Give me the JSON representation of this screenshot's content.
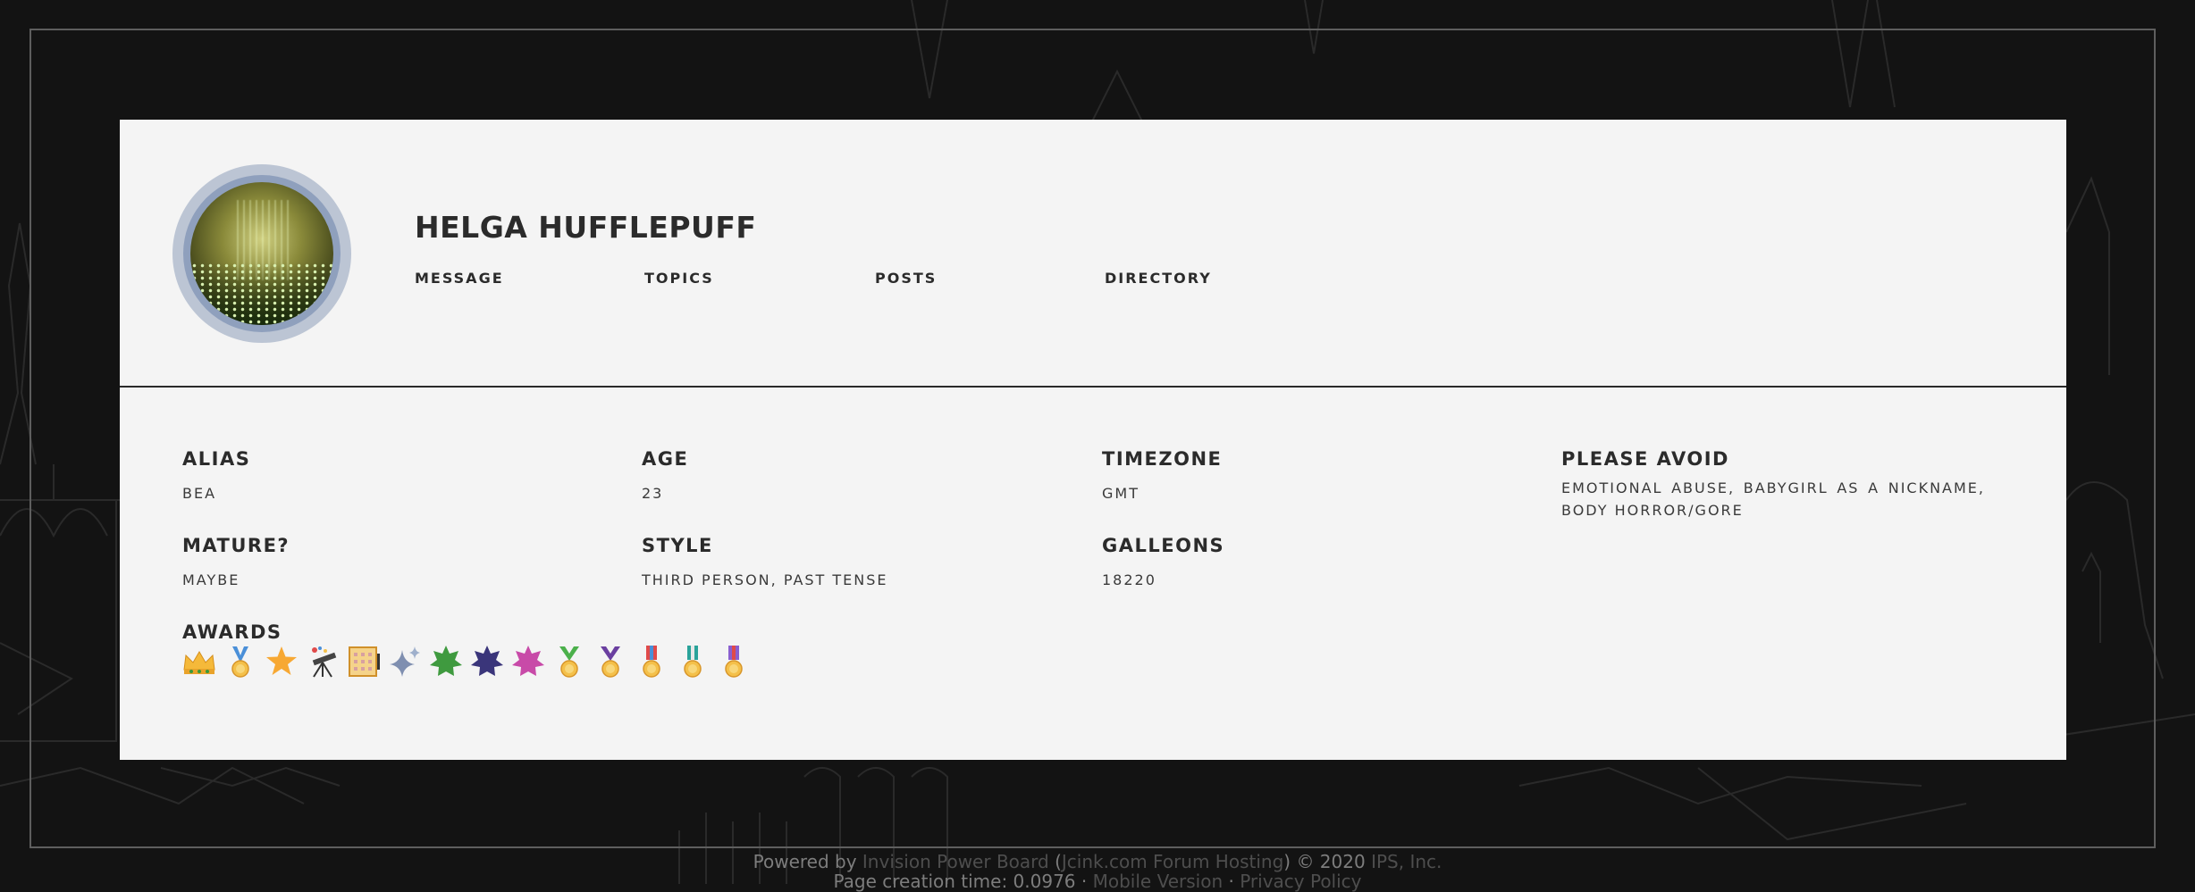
{
  "profile": {
    "name": "HELGA HUFFLEPUFF",
    "nav": [
      "MESSAGE",
      "TOPICS",
      "POSTS",
      "DIRECTORY"
    ]
  },
  "fields": {
    "alias": {
      "label": "ALIAS",
      "value": "BEA"
    },
    "age": {
      "label": "AGE",
      "value": "23"
    },
    "timezone": {
      "label": "TIMEZONE",
      "value": "GMT"
    },
    "avoid": {
      "label": "PLEASE AVOID",
      "value": "EMOTIONAL ABUSE, BABYGIRL AS A NICKNAME, BODY HORROR/GORE"
    },
    "mature": {
      "label": "MATURE?",
      "value": "MAYBE"
    },
    "style": {
      "label": "STYLE",
      "value": "THIRD PERSON, PAST TENSE"
    },
    "galleons": {
      "label": "GALLEONS",
      "value": "18220"
    }
  },
  "awards": {
    "label": "AWARDS",
    "icons": [
      "crown-icon",
      "blue-medal-icon",
      "gold-star-icon",
      "telescope-icon",
      "calendar-icon",
      "sparkles-icon",
      "green-star-icon",
      "purple-star-icon",
      "pink-star-icon",
      "green-medal-icon",
      "purple-medal-icon",
      "red-ribbon-medal-icon",
      "teal-ribbon-medal-icon",
      "purple-ribbon-medal-icon"
    ]
  },
  "footer": {
    "powered_by": "Powered by",
    "ipb_link": "Invision Power Board",
    "hosting_link": "Jcink.com Forum Hosting",
    "copyright": "© 2020",
    "ips_link": "IPS, Inc.",
    "page_time": "Page creation time: 0.0976 ·",
    "mobile_link": "Mobile Version",
    "privacy_link": "Privacy Policy"
  },
  "colors": {
    "background": "#131313",
    "card": "#f4f4f4",
    "text": "#2b2b2b",
    "avatar_ring": "#bcc5d4"
  }
}
